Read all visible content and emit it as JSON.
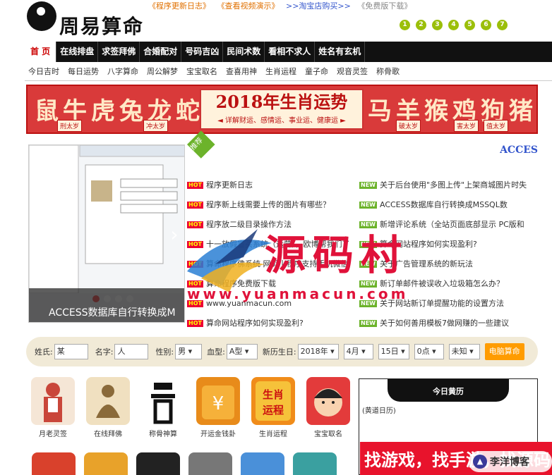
{
  "header": {
    "logo_text": "周易算命",
    "top_links": [
      {
        "label": "《程序更新日志》",
        "color": "orange"
      },
      {
        "label": "《查看视频演示》",
        "color": "orange"
      },
      {
        "label": ">>淘宝店购买>>",
        "color": "blue"
      },
      {
        "label": "《免费版下载》",
        "color": "gray"
      }
    ],
    "number_dots": [
      "1",
      "2",
      "3",
      "4",
      "5",
      "6",
      "7"
    ]
  },
  "nav": {
    "items": [
      "首 页",
      "在线排盘",
      "求签拜佛",
      "合婚配对",
      "号码吉凶",
      "民间术数",
      "看相不求人",
      "姓名有玄机"
    ]
  },
  "subnav": {
    "items": [
      "今日吉时",
      "每日运势",
      "八字算命",
      "周公解梦",
      "宝宝取名",
      "查喜用神",
      "生肖运程",
      "童子命",
      "观音灵签",
      "称骨歌"
    ]
  },
  "banner": {
    "left_text": "鼠牛虎兔龙蛇",
    "title": "2018年生肖运势",
    "subtitle": "◄ 详解财运、感情运、事业运、健康运 ►",
    "right_text": "马羊猴鸡狗猪",
    "tags": [
      "刑太岁",
      "冲太岁",
      "破太岁",
      "害太岁",
      "值太岁"
    ]
  },
  "slider": {
    "caption": "ACCESS数据库自行转换成M",
    "prev": "‹",
    "next": "›"
  },
  "news": {
    "ribbon": "推荐",
    "top_title": "ACCES",
    "hot_label": "HOT",
    "new_label": "NEW",
    "left": [
      "程序更新日志",
      "程序新上线需要上传的图片有哪些？",
      "程序放二级目录操作方法",
      "十一放假宣买系统（运营），欧博帮我们了",
      "算命程序佛系统 网页小程序支持手机微信",
      "算命程序免费版下载",
      "www.yuanmacun.com",
      "算命网站程序如何实现盈利?"
    ],
    "right": [
      "关于后台使用\"多图上传\"上架商城图片时失",
      "ACCESS数据库自行转换成MSSQL数",
      "新增评论系统（全站页面底部显示 PC版和",
      "算命网站程序如何实现盈利?",
      "关于广告管理系统的新玩法",
      "新订单邮件被误收入垃圾箱怎么办？",
      "关于网站新订单提醒功能的设置方法",
      "关于如何善用模板7做网赚的一些建议"
    ]
  },
  "watermark": {
    "cn": "源码村",
    "url": "www.yuanmacun.com"
  },
  "form": {
    "surname_label": "姓氏:",
    "surname_value": "某",
    "name_label": "名字:",
    "name_value": "人",
    "gender_label": "性别:",
    "gender_value": "男 ▾",
    "blood_label": "血型:",
    "blood_value": "A型 ▾",
    "birth_label": "新历生日:",
    "year_value": "2018年 ▾",
    "month_value": "4月 ▾",
    "day_value": "15日 ▾",
    "hour_value": "0点 ▾",
    "unknown_value": "未知 ▾",
    "submit": "电脑算命"
  },
  "apps": [
    {
      "label": "月老灵签",
      "color": "#c9463a"
    },
    {
      "label": "在线拜佛",
      "color": "#f0e0c0"
    },
    {
      "label": "称骨神算",
      "color": "#ffffff"
    },
    {
      "label": "开运金钱卦",
      "color": "#e88b1a"
    },
    {
      "label": "生肖运程",
      "color": "#f08c1a"
    },
    {
      "label": "宝宝取名",
      "color": "#e33b3b"
    }
  ],
  "calendar": {
    "title": "今日黄历",
    "text": "(黄道日历)"
  },
  "ad": {
    "text": "找游戏，找手游，找源码",
    "badge": "李洋博客"
  },
  "colors": {
    "nav_bg": "#111111",
    "accent_red": "#d93a3a",
    "dot_green": "#9bbf0a",
    "form_bg": "#f1ead7",
    "submit_orange": "#ff9c00"
  }
}
